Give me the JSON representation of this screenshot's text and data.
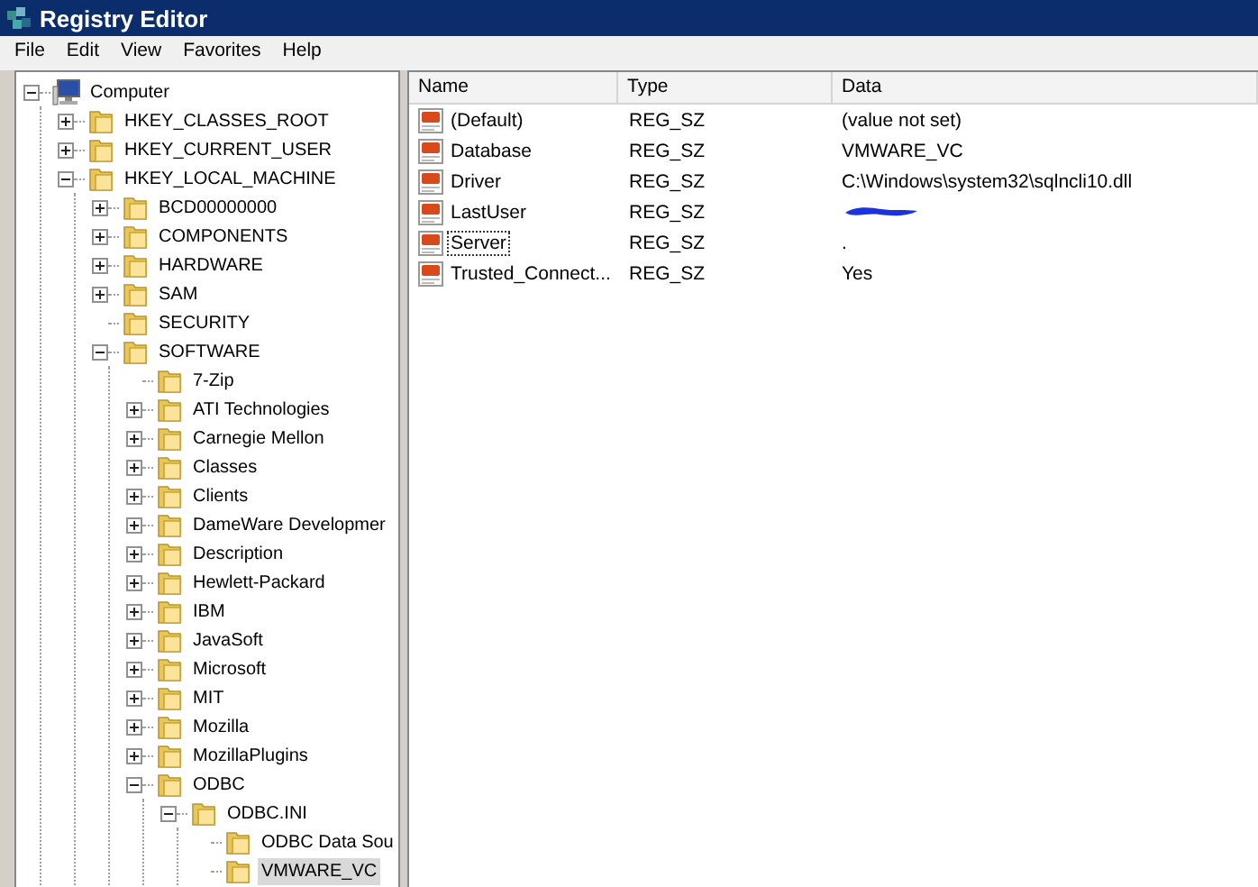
{
  "window": {
    "title": "Registry Editor"
  },
  "menu": [
    "File",
    "Edit",
    "View",
    "Favorites",
    "Help"
  ],
  "tree": [
    {
      "label": "Computer",
      "kind": "computer",
      "has_subkeys": true,
      "expanded": true,
      "selected": false,
      "children": [
        {
          "label": "HKEY_CLASSES_ROOT",
          "has_subkeys": true,
          "expanded": false,
          "selected": false
        },
        {
          "label": "HKEY_CURRENT_USER",
          "has_subkeys": true,
          "expanded": false,
          "selected": false
        },
        {
          "label": "HKEY_LOCAL_MACHINE",
          "has_subkeys": true,
          "expanded": true,
          "selected": false,
          "children": [
            {
              "label": "BCD00000000",
              "has_subkeys": true,
              "expanded": false,
              "selected": false
            },
            {
              "label": "COMPONENTS",
              "has_subkeys": true,
              "expanded": false,
              "selected": false
            },
            {
              "label": "HARDWARE",
              "has_subkeys": true,
              "expanded": false,
              "selected": false
            },
            {
              "label": "SAM",
              "has_subkeys": true,
              "expanded": false,
              "selected": false
            },
            {
              "label": "SECURITY",
              "has_subkeys": false,
              "selected": false
            },
            {
              "label": "SOFTWARE",
              "has_subkeys": true,
              "expanded": true,
              "selected": false,
              "children": [
                {
                  "label": "7-Zip",
                  "has_subkeys": false,
                  "selected": false
                },
                {
                  "label": "ATI Technologies",
                  "has_subkeys": true,
                  "expanded": false,
                  "selected": false
                },
                {
                  "label": "Carnegie Mellon",
                  "has_subkeys": true,
                  "expanded": false,
                  "selected": false
                },
                {
                  "label": "Classes",
                  "has_subkeys": true,
                  "expanded": false,
                  "selected": false
                },
                {
                  "label": "Clients",
                  "has_subkeys": true,
                  "expanded": false,
                  "selected": false
                },
                {
                  "label": "DameWare Developmer",
                  "has_subkeys": true,
                  "expanded": false,
                  "selected": false
                },
                {
                  "label": "Description",
                  "has_subkeys": true,
                  "expanded": false,
                  "selected": false
                },
                {
                  "label": "Hewlett-Packard",
                  "has_subkeys": true,
                  "expanded": false,
                  "selected": false
                },
                {
                  "label": "IBM",
                  "has_subkeys": true,
                  "expanded": false,
                  "selected": false
                },
                {
                  "label": "JavaSoft",
                  "has_subkeys": true,
                  "expanded": false,
                  "selected": false
                },
                {
                  "label": "Microsoft",
                  "has_subkeys": true,
                  "expanded": false,
                  "selected": false
                },
                {
                  "label": "MIT",
                  "has_subkeys": true,
                  "expanded": false,
                  "selected": false
                },
                {
                  "label": "Mozilla",
                  "has_subkeys": true,
                  "expanded": false,
                  "selected": false
                },
                {
                  "label": "MozillaPlugins",
                  "has_subkeys": true,
                  "expanded": false,
                  "selected": false
                },
                {
                  "label": "ODBC",
                  "has_subkeys": true,
                  "expanded": true,
                  "selected": false,
                  "children": [
                    {
                      "label": "ODBC.INI",
                      "has_subkeys": true,
                      "expanded": true,
                      "selected": false,
                      "children": [
                        {
                          "label": "ODBC Data Sou",
                          "has_subkeys": false,
                          "selected": false
                        },
                        {
                          "label": "VMWARE_VC",
                          "has_subkeys": false,
                          "selected": true
                        }
                      ]
                    }
                  ]
                }
              ]
            }
          ]
        }
      ]
    }
  ],
  "values": {
    "columns": [
      "Name",
      "Type",
      "Data"
    ],
    "rows": [
      {
        "name": "(Default)",
        "type": "REG_SZ",
        "data": "(value not set)",
        "redacted": false,
        "focused": false
      },
      {
        "name": "Database",
        "type": "REG_SZ",
        "data": "VMWARE_VC",
        "redacted": false,
        "focused": false
      },
      {
        "name": "Driver",
        "type": "REG_SZ",
        "data": "C:\\Windows\\system32\\sqlncli10.dll",
        "redacted": false,
        "focused": false
      },
      {
        "name": "LastUser",
        "type": "REG_SZ",
        "redacted": true,
        "focused": false
      },
      {
        "name": "Server",
        "type": "REG_SZ",
        "data": ".",
        "redacted": false,
        "focused": true
      },
      {
        "name": "Trusted_Connect...",
        "type": "REG_SZ",
        "data": "Yes",
        "redacted": false,
        "focused": false
      }
    ]
  }
}
